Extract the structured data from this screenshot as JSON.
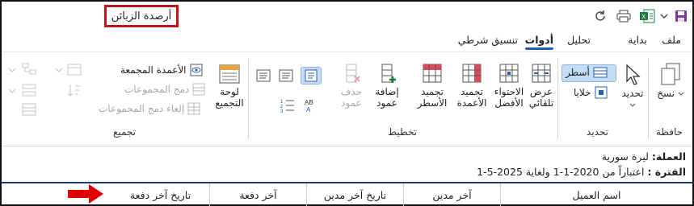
{
  "titlebar": {
    "doc_title": "أرصدة الزبائن",
    "icons": [
      "refresh-icon",
      "print-icon",
      "excel-export-icon",
      "chevron-down-icon",
      "save-icon"
    ]
  },
  "tabs": [
    {
      "label": "ملف"
    },
    {
      "label": "بداية"
    },
    {
      "label": "تحليل"
    },
    {
      "label": "أدوات",
      "active": true
    },
    {
      "label": "تنسيق شرطي"
    }
  ],
  "ribbon": {
    "groups": {
      "clipboard": {
        "label": "حافظة",
        "copy": "نسخ"
      },
      "select": {
        "label": "تحديد",
        "select": "تحديد",
        "rows": "أسطر",
        "cells": "خلايا"
      },
      "layout": {
        "label": "تخطيط",
        "fit_width": [
          "عرض",
          "تلقائي"
        ],
        "best_fit": [
          "الاحتواء",
          "الأفضل"
        ],
        "freeze_cols": [
          "تجميد",
          "الأعمدة"
        ],
        "freeze_rows": [
          "تجميد",
          "الأسطر"
        ],
        "add_col": [
          "إضافة",
          "عمود"
        ],
        "del_col": [
          "حذف",
          "عمود"
        ]
      },
      "grouping": {
        "label": "تجميع",
        "panel": [
          "لوحة",
          "التجميع"
        ],
        "grouped_cols": "الأعمدة المجمعة",
        "merge_groups": "دمج المجموعات",
        "unmerge_groups": "إلغاء دمج المجموعات"
      }
    }
  },
  "report": {
    "currency_label": "العملة:",
    "currency_value": "ليرة سورية",
    "period_label": "الفترة :",
    "period_value": "اعتباراً من 2020-1-1 ولغاية 2025-5-1"
  },
  "table": {
    "headers": [
      "اسم العميل",
      "آخر مدين",
      "تاريخ آخر مدين",
      "آخر دفعة",
      "تاريخ آخر دفعة"
    ]
  },
  "colors": {
    "highlight_box": "#c0141b",
    "accent": "#1a5fb4",
    "header_rule": "#1e3f7c",
    "arrow": "#e00000"
  }
}
